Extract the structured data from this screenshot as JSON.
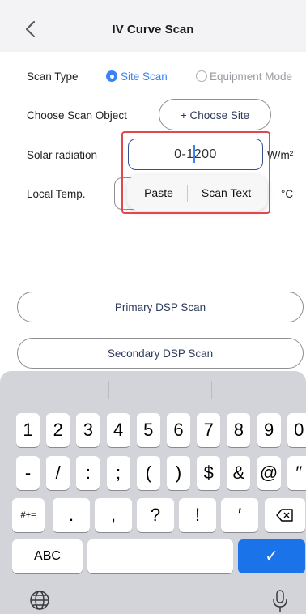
{
  "header": {
    "title": "IV Curve Scan"
  },
  "form": {
    "scan_type_label": "Scan Type",
    "option_site": "Site Scan",
    "option_equipment": "Equipment Mode",
    "choose_object_label": "Choose Scan Object",
    "choose_site_button": "+ Choose Site",
    "solar_label": "Solar radiation",
    "solar_value": "0-1200",
    "solar_unit": "W/m²",
    "temp_label": "Local Temp.",
    "temp_unit": "°C"
  },
  "context_menu": {
    "paste": "Paste",
    "scan_text": "Scan Text"
  },
  "buttons": {
    "primary": "Primary DSP Scan",
    "secondary": "Secondary DSP Scan"
  },
  "keyboard": {
    "row1": [
      "1",
      "2",
      "3",
      "4",
      "5",
      "6",
      "7",
      "8",
      "9",
      "0"
    ],
    "row2": [
      "-",
      "/",
      ":",
      ";",
      "(",
      ")",
      "$",
      "&",
      "@",
      "″"
    ],
    "row3_mode": "#+=",
    "row3": [
      ".",
      ",",
      "?",
      "!",
      "′"
    ],
    "abc": "ABC",
    "done": "✓",
    "accent_color": "#1a73e8"
  }
}
